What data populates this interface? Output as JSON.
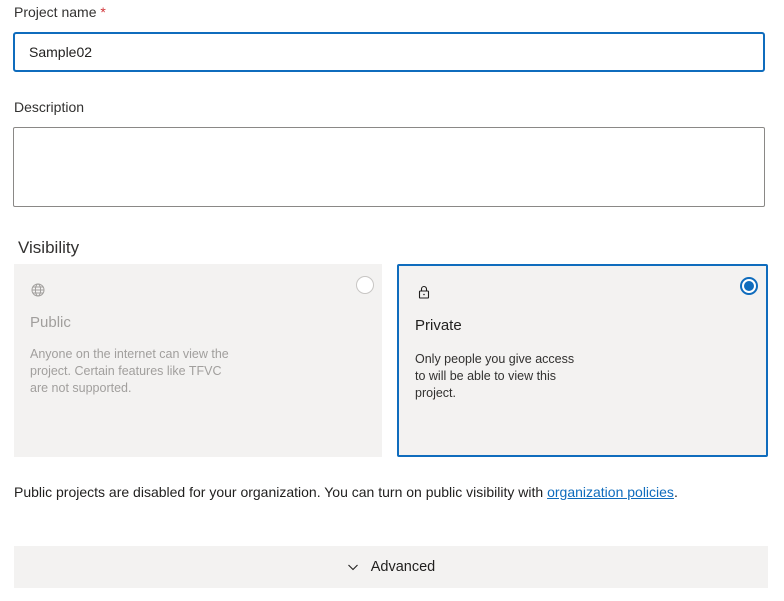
{
  "project_name": {
    "label": "Project name",
    "required_marker": "*",
    "value": "Sample02"
  },
  "description": {
    "label": "Description",
    "value": ""
  },
  "visibility": {
    "heading": "Visibility",
    "options": [
      {
        "title": "Public",
        "description": "Anyone on the internet can view the project. Certain features like TFVC are not supported.",
        "icon": "globe-icon",
        "selected": false,
        "disabled": true
      },
      {
        "title": "Private",
        "description": "Only people you give access to will be able to view this project.",
        "icon": "lock-icon",
        "selected": true,
        "disabled": false
      }
    ]
  },
  "notice": {
    "text": "Public projects are disabled for your organization. You can turn on public visibility with ",
    "link_text": "organization policies",
    "suffix": "."
  },
  "advanced": {
    "label": "Advanced",
    "icon": "chevron-down-icon"
  },
  "colors": {
    "accent": "#0f6cbd",
    "required": "#d13438",
    "card_background": "#f3f2f1",
    "disabled_text": "#a19f9d"
  }
}
